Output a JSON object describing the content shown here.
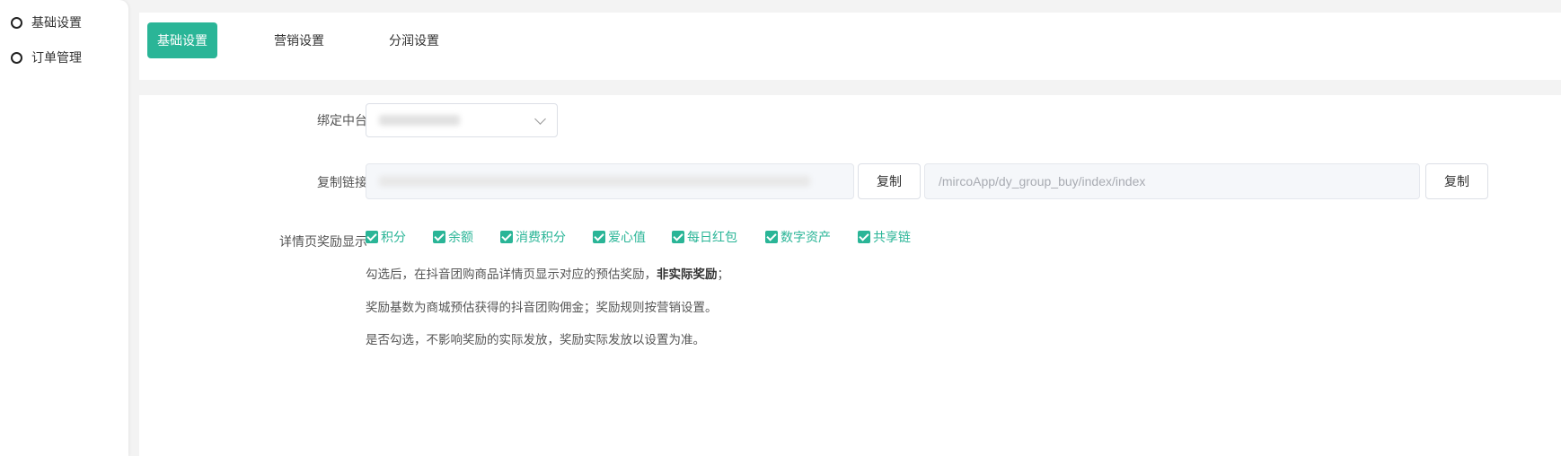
{
  "sidebar": {
    "items": [
      {
        "label": "基础设置",
        "icon": "circle-outline-icon"
      },
      {
        "label": "订单管理",
        "icon": "circle-outline-icon"
      }
    ]
  },
  "tabs": [
    {
      "label": "基础设置",
      "active": true
    },
    {
      "label": "营销设置",
      "active": false
    },
    {
      "label": "分润设置",
      "active": false
    }
  ],
  "form": {
    "bind_label": "绑定中台",
    "bind_value": "",
    "copy_link_label": "复制链接",
    "link_primary": "",
    "link_secondary": "/mircoApp/dy_group_buy/index/index",
    "copy_button": "复制",
    "reward_label": "详情页奖励显示",
    "rewards": [
      {
        "label": "积分",
        "checked": true
      },
      {
        "label": "余额",
        "checked": true
      },
      {
        "label": "消费积分",
        "checked": true
      },
      {
        "label": "爱心值",
        "checked": true
      },
      {
        "label": "每日红包",
        "checked": true
      },
      {
        "label": "数字资产",
        "checked": true
      },
      {
        "label": "共享链",
        "checked": true
      }
    ],
    "tips": {
      "line1_prefix": "勾选后，在抖音团购商品详情页显示对应的预估奖励，",
      "line1_bold": "非实际奖励",
      "line1_suffix": "；",
      "line2": "奖励基数为商城预估获得的抖音团购佣金；奖励规则按营销设置。",
      "line3": "是否勾选，不影响奖励的实际发放，奖励实际发放以设置为准。"
    }
  },
  "colors": {
    "accent": "#2ab597"
  }
}
